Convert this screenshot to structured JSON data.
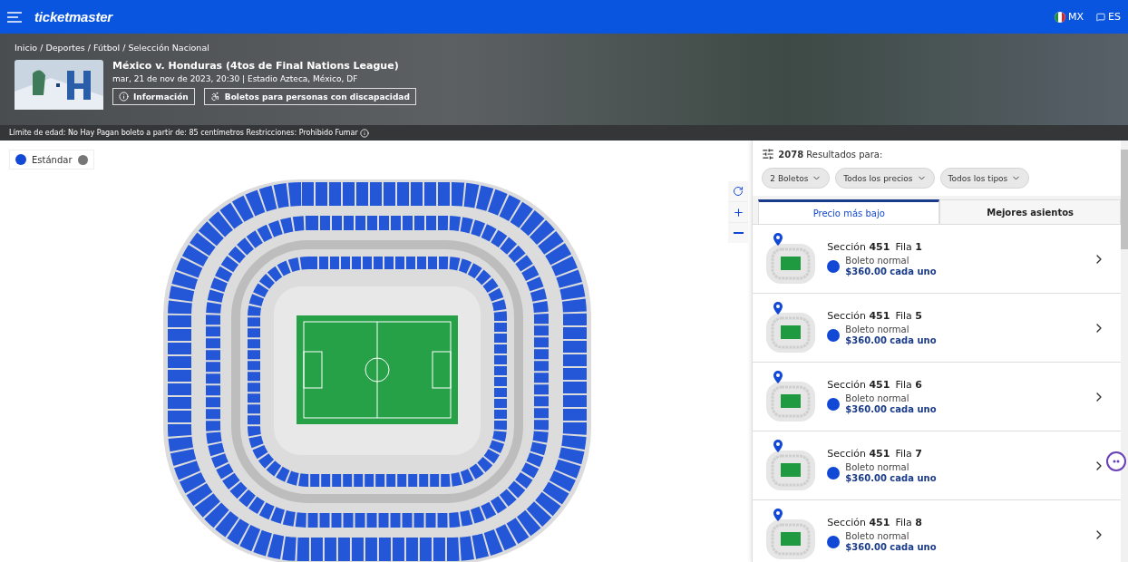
{
  "header": {
    "logo": "ticketmaster",
    "country": "MX",
    "language": "ES"
  },
  "event": {
    "breadcrumb": "Inicio / Deportes / Fútbol / Selección Nacional",
    "title": "México v. Honduras (4tos de Final Nations League)",
    "date_venue": "mar, 21 de nov de 2023, 20:30 | Estadio Azteca, México, DF",
    "buttons": [
      {
        "kind": "info",
        "label": "Información"
      },
      {
        "kind": "accessible",
        "label": "Boletos para personas con discapacidad"
      }
    ],
    "restrictions": "Límite de edad: No Hay Pagan boleto a partir de: 85 centímetros Restricciones: Prohibido Fumar"
  },
  "legend": {
    "label": "Estándar",
    "color": "#1248d6"
  },
  "results": {
    "summary": "**2078** Resultados para:",
    "filters": [
      "2 Boletos",
      "Todos los precios",
      "Todos los tipos"
    ],
    "tabs": [
      {
        "label": "Precio más bajo",
        "selected": true
      },
      {
        "label": "Mejores asientos",
        "selected": false
      }
    ],
    "listings": [
      {
        "section": "Sección **451**",
        "row": "Fila **1**",
        "ticket_type": "Boleto normal",
        "price": "$360.00 cada uno",
        "color": "#1248d6"
      },
      {
        "section": "Sección **451**",
        "row": "Fila **5**",
        "ticket_type": "Boleto normal",
        "price": "$360.00 cada uno",
        "color": "#1248d6"
      },
      {
        "section": "Sección **451**",
        "row": "Fila **6**",
        "ticket_type": "Boleto normal",
        "price": "$360.00 cada uno",
        "color": "#1248d6"
      },
      {
        "section": "Sección **451**",
        "row": "Fila **7**",
        "ticket_type": "Boleto normal",
        "price": "$360.00 cada uno",
        "color": "#1248d6"
      },
      {
        "section": "Sección **451**",
        "row": "Fila **8**",
        "ticket_type": "Boleto normal",
        "price": "$360.00 cada uno",
        "color": "#1248d6"
      }
    ]
  }
}
